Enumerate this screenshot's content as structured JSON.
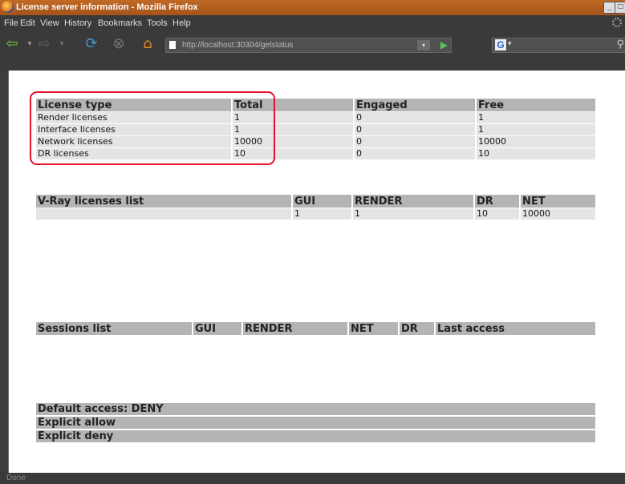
{
  "window": {
    "title": "License server information - Mozilla Firefox"
  },
  "menu": [
    "File",
    "Edit",
    "View",
    "History",
    "Bookmarks",
    "Tools",
    "Help"
  ],
  "nav": {
    "url": "http://localhost:30304/getstatus"
  },
  "status_text": "Done",
  "license_table": {
    "headers": [
      "License type",
      "Total",
      "Engaged",
      "Free"
    ],
    "rows": [
      [
        "Render licenses",
        "1",
        "0",
        "1"
      ],
      [
        "Interface licenses",
        "1",
        "0",
        "1"
      ],
      [
        "Network licenses",
        "10000",
        "0",
        "10000"
      ],
      [
        "DR licenses",
        "10",
        "0",
        "10"
      ]
    ]
  },
  "vray_table": {
    "headers": [
      "V-Ray licenses list",
      "GUI",
      "RENDER",
      "DR",
      "NET"
    ],
    "rows": [
      [
        "",
        "1",
        "1",
        "10",
        "10000"
      ]
    ]
  },
  "sessions_table": {
    "headers": [
      "Sessions list",
      "GUI",
      "RENDER",
      "NET",
      "DR",
      "Last access"
    ]
  },
  "access": {
    "default": "Default access: DENY",
    "allow": "Explicit allow",
    "deny": "Explicit deny"
  },
  "colors": {
    "highlight": "#e8102a",
    "titlebar": "#b15c1f"
  }
}
